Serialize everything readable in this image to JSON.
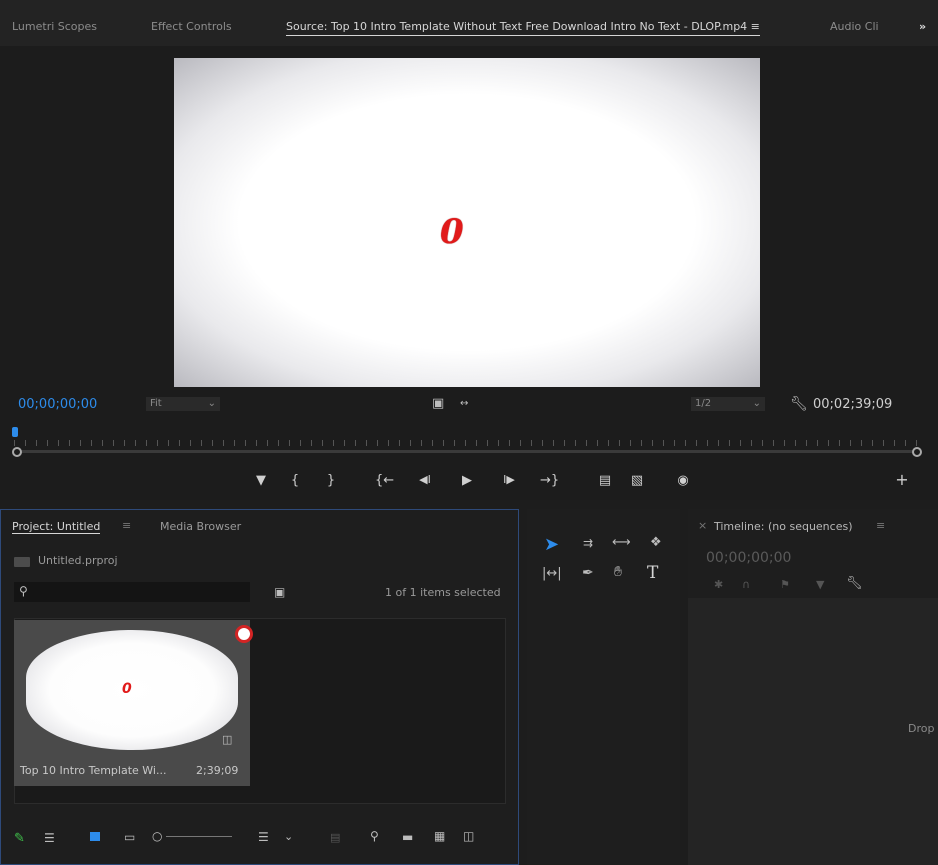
{
  "tabs": [
    "Lumetri Scopes",
    "Effect Controls",
    "Source: Top 10 Intro Template Without Text Free Download Intro No Text - DLOP.mp4 ≡",
    "Audio Cli"
  ],
  "tabs_overflow": "»",
  "source": {
    "video_digit": "0",
    "timecode_in": "00;00;00;00",
    "zoom_label": "Fit",
    "resolution_label": "1/2",
    "timecode_out": "00;02;39;09"
  },
  "project": {
    "tab_label": "Project: Untitled",
    "tab_menu": "≡",
    "media_browser_label": "Media Browser",
    "file_name": "Untitled.prproj",
    "selection_status": "1 of 1 items selected",
    "clip_name": "Top 10 Intro Template Wi...",
    "clip_duration": "2;39;09",
    "clip_digit": "0"
  },
  "timeline": {
    "close_glyph": "×",
    "title": "Timeline: (no sequences)",
    "menu_glyph": "≡",
    "timecode": "00;00;00;00",
    "drop_hint": "Drop"
  },
  "tools": {
    "type_tool_glyph": "T"
  },
  "colors": {
    "accent": "#2d8ceb",
    "panel_bg": "#1e1e1e",
    "video_mark": "#e11a1a"
  },
  "icons": [
    "add-icon",
    "marker-icon",
    "mark-in-icon",
    "mark-out-icon",
    "go-to-in-icon",
    "step-back-icon",
    "play-icon",
    "step-forward-icon",
    "go-to-out-icon",
    "insert-icon",
    "overwrite-icon",
    "export-frame-icon",
    "wrench-icon",
    "search-icon",
    "new-bin-icon",
    "selection-tool-icon",
    "track-select-icon",
    "ripple-edit-icon",
    "razor-icon",
    "slip-tool-icon",
    "pen-tool-icon",
    "hand-tool-icon",
    "type-tool-icon"
  ]
}
